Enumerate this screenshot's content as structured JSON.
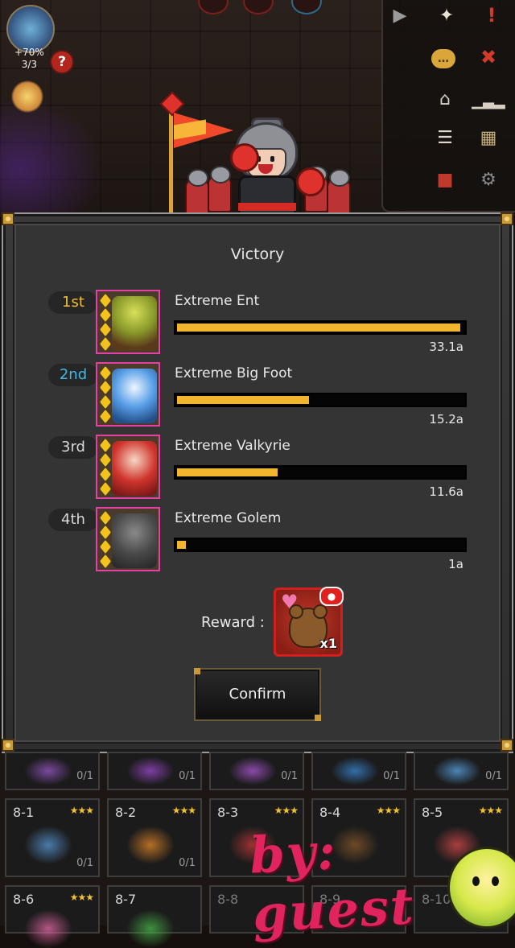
{
  "hud": {
    "boost_percent": "+70%",
    "boost_count": "3/3",
    "help_label": "?"
  },
  "dialog": {
    "title": "Victory",
    "rankings": [
      {
        "rank": "1st",
        "rank_color": "#f2c12e",
        "name": "Extreme Ent",
        "damage": "33.1a",
        "fill_fraction": 0.99
      },
      {
        "rank": "2nd",
        "rank_color": "#3fb9e8",
        "name": "Extreme Big Foot",
        "damage": "15.2a",
        "fill_fraction": 0.46
      },
      {
        "rank": "3rd",
        "rank_color": "#d8d8d8",
        "name": "Extreme Valkyrie",
        "damage": "11.6a",
        "fill_fraction": 0.35
      },
      {
        "rank": "4th",
        "rank_color": "#d8d8d8",
        "name": "Extreme Golem",
        "damage": "1a",
        "fill_fraction": 0.03
      }
    ],
    "reward_label": "Reward :",
    "reward_qty": "x1",
    "confirm_label": "Confirm"
  },
  "stages": {
    "row_top": [
      {
        "count": "0/1"
      },
      {
        "count": "0/1"
      },
      {
        "count": "0/1"
      },
      {
        "count": "0/1"
      },
      {
        "count": "0/1"
      }
    ],
    "row_mid": [
      {
        "label": "8-1",
        "count": "0/1"
      },
      {
        "label": "8-2",
        "count": "0/1"
      },
      {
        "label": "8-3",
        "count": ""
      },
      {
        "label": "8-4",
        "count": ""
      },
      {
        "label": "8-5",
        "count": ""
      }
    ],
    "row_bottom": [
      {
        "label": "8-6"
      },
      {
        "label": "8-7"
      },
      {
        "label": "8-8"
      },
      {
        "label": "8-9"
      },
      {
        "label": "8-10"
      }
    ],
    "star_glyphs": "★★★"
  },
  "watermark": "by: guest",
  "colors": {
    "accent_gold": "#f2b52e",
    "portrait_border": "#e63fa6",
    "reward_border": "#d01f1f",
    "watermark": "#e0245e"
  }
}
